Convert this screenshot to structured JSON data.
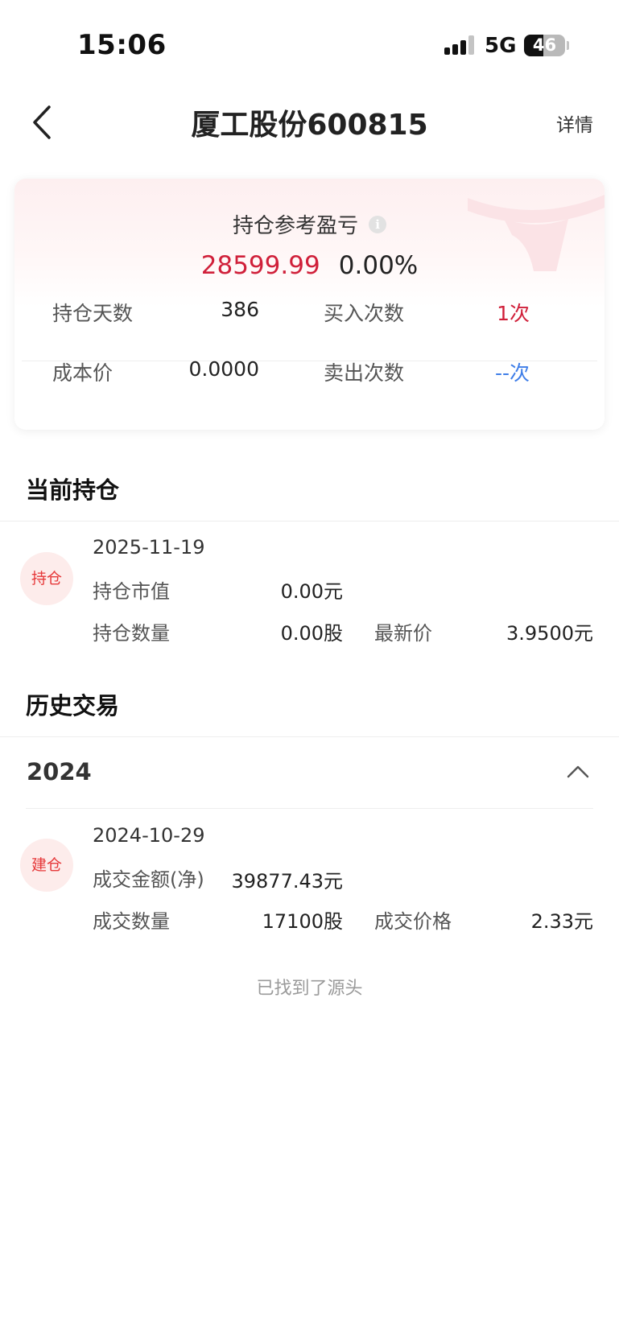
{
  "status_bar": {
    "time": "15:06",
    "network": "5G",
    "battery": "46"
  },
  "nav": {
    "back_icon": "chevron-left-icon",
    "title": "厦工股份600815",
    "detail_label": "详情"
  },
  "summary": {
    "label": "持仓参考盈亏",
    "info_icon": "info-icon",
    "pnl_value": "28599.99",
    "pnl_percent": "0.00%",
    "holding_days_label": "持仓天数",
    "holding_days_value": "386",
    "buy_count_label": "买入次数",
    "buy_count_value": "1次",
    "cost_label": "成本价",
    "cost_value": "0.0000",
    "sell_count_label": "卖出次数",
    "sell_count_value": "--次"
  },
  "current_position": {
    "title": "当前持仓",
    "badge": "持仓",
    "date": "2025-11-19",
    "market_value_label": "持仓市值",
    "market_value": "0.00元",
    "quantity_label": "持仓数量",
    "quantity": "0.00股",
    "latest_price_label": "最新价",
    "latest_price": "3.9500元"
  },
  "history": {
    "title": "历史交易",
    "year": "2024",
    "collapse_icon": "chevron-up-icon",
    "trades": [
      {
        "badge": "建仓",
        "date": "2024-10-29",
        "amount_label": "成交金额(净)",
        "amount": "39877.43元",
        "quantity_label": "成交数量",
        "quantity": "17100股",
        "price_label": "成交价格",
        "price": "2.33元"
      }
    ],
    "end_note": "已找到了源头"
  },
  "colors": {
    "profit_red": "#d0203a",
    "link_blue": "#3f7ee8",
    "badge_bg": "#fdeceb",
    "badge_text": "#e6393a"
  }
}
